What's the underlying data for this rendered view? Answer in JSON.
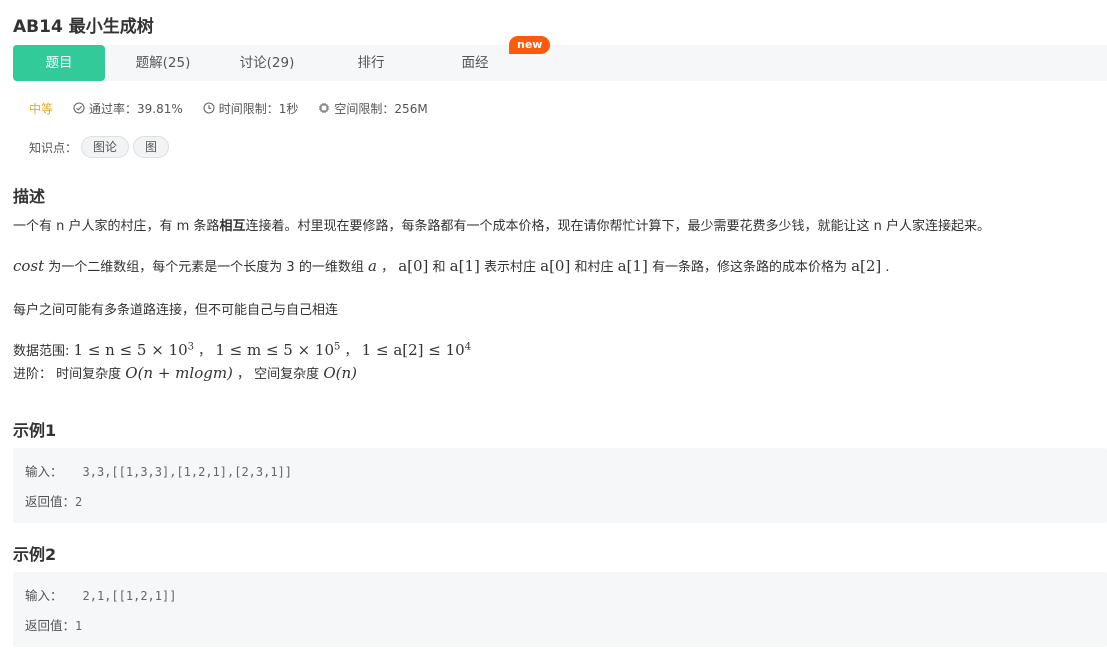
{
  "problem": {
    "title": "AB14  最小生成树"
  },
  "tabs": [
    {
      "label": "题目",
      "active": true
    },
    {
      "label": "题解(25)",
      "active": false
    },
    {
      "label": "讨论(29)",
      "active": false
    },
    {
      "label": "排行",
      "active": false
    },
    {
      "label": "面经",
      "active": false
    }
  ],
  "new_badge": "new",
  "meta": {
    "difficulty": "中等",
    "pass_rate": "通过率：39.81%",
    "time_limit": "时间限制：1秒",
    "space_limit": "空间限制：256M"
  },
  "knowledge": {
    "label": "知识点：",
    "tags": [
      "图论",
      "图"
    ]
  },
  "description": {
    "heading": "描述",
    "p1_a": "一个有 n 户人家的村庄，有 m 条路",
    "p1_bold": "相互",
    "p1_b": "连接着。村里现在要修路，每条路都有一个成本价格，现在请你帮忙计算下，最少需要花费多少钱，就能让这 n 户人家连接起来。",
    "p2": {
      "cost": "cost",
      "t1": " 为一个二维数组，每个元素是一个长度为 3 的一维数组 ",
      "a": "a",
      "sep": " ，  ",
      "a0": "a[0]",
      "and": " 和 ",
      "a1": "a[1]",
      "t2": " 表示村庄 ",
      "t3": " 和村庄 ",
      "t4": " 有一条路，修这条路的成本价格为 ",
      "a2": "a[2]",
      "end": " ."
    },
    "p3": "每户之间可能有多条道路连接，但不可能自己与自己相连",
    "range_label": "数据范围: ",
    "range_1": "1 ≤ n ≤ 5 × 10",
    "range_1_exp": "3",
    "range_2": "1 ≤ m ≤ 5 × 10",
    "range_2_exp": "5",
    "range_3": "1 ≤ a[2] ≤ 10",
    "range_3_exp": "4",
    "sep": " ，  ",
    "adv_label": "进阶：  时间复杂度 ",
    "time_complexity": "O(n + mlogm)",
    "space_label": " ，  空间复杂度 ",
    "space_complexity": "O(n)"
  },
  "examples": [
    {
      "heading": "示例1",
      "input_label": "输入：",
      "input": "3,3,[[1,3,3],[1,2,1],[2,3,1]]",
      "output_label": "返回值：",
      "output": "2"
    },
    {
      "heading": "示例2",
      "input_label": "输入：",
      "input": "2,1,[[1,2,1]]",
      "output_label": "返回值：",
      "output": "1"
    }
  ],
  "colors": {
    "accent": "#32ca99",
    "badge": "#fa5b0f",
    "difficulty": "#e5a822"
  }
}
